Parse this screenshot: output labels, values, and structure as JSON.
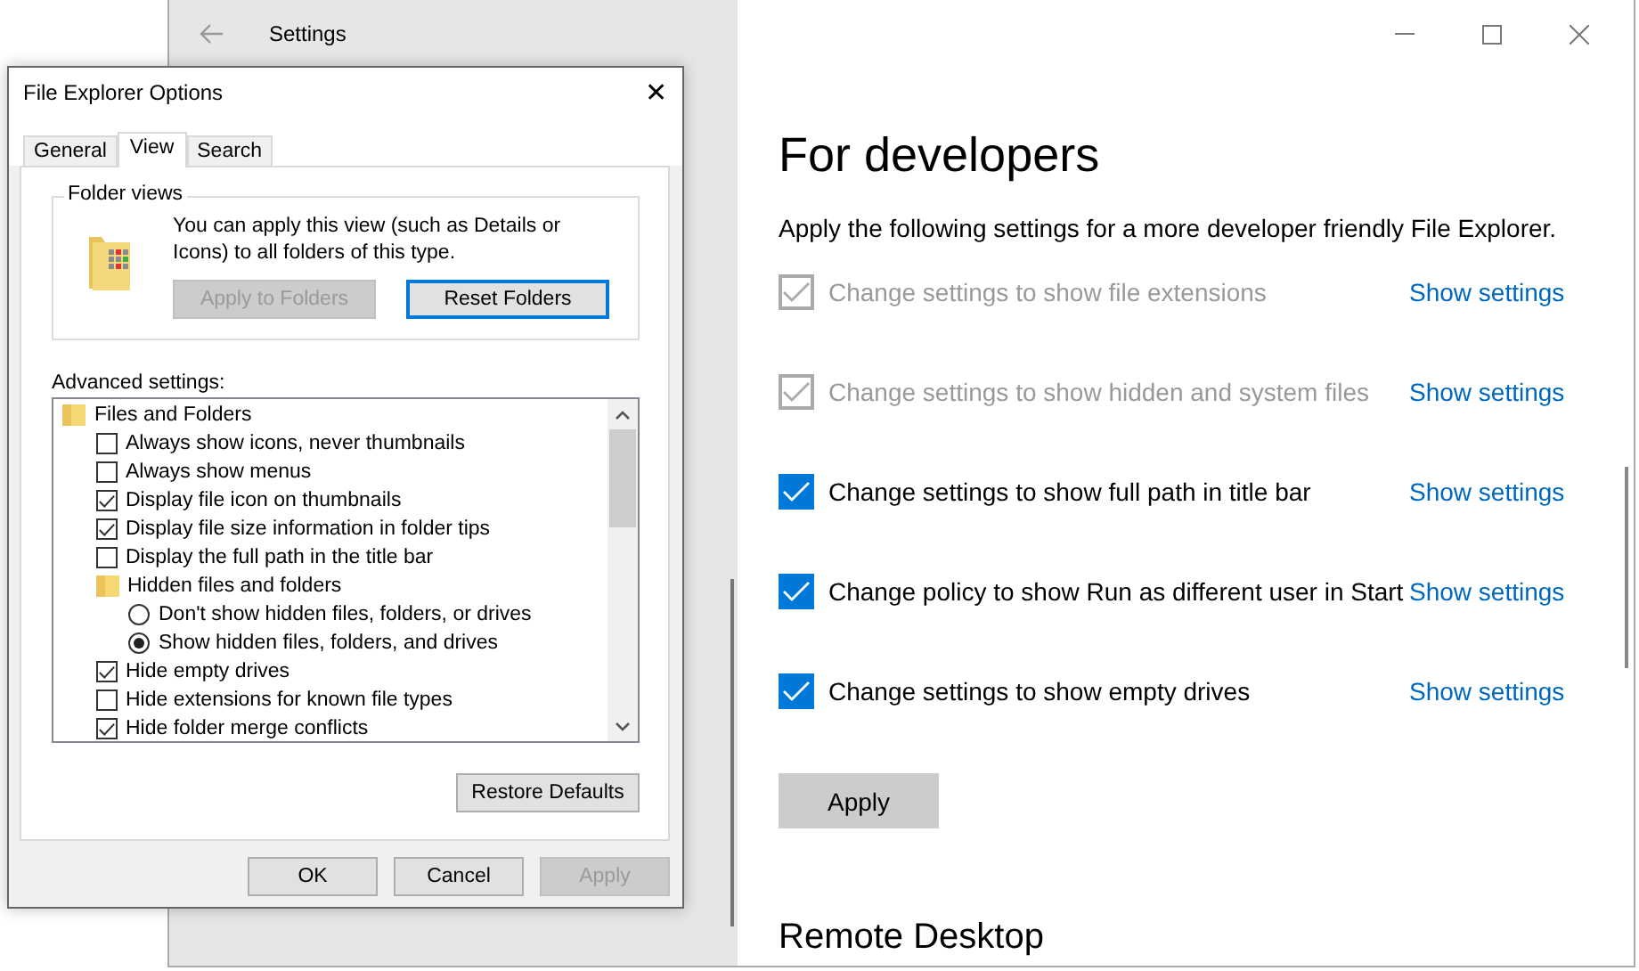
{
  "settings_window": {
    "title": "Settings",
    "heading": "For developers",
    "description": "Apply the following settings for a more developer friendly File Explorer.",
    "options": [
      {
        "label": "Change settings to show file extensions",
        "checked": true,
        "disabled": true,
        "link": "Show settings"
      },
      {
        "label": "Change settings to show hidden and system files",
        "checked": true,
        "disabled": true,
        "link": "Show settings"
      },
      {
        "label": "Change settings to show full path in title bar",
        "checked": true,
        "disabled": false,
        "link": "Show settings"
      },
      {
        "label": "Change policy to show Run as different user in Start",
        "checked": true,
        "disabled": false,
        "link": "Show settings"
      },
      {
        "label": "Change settings to show empty drives",
        "checked": true,
        "disabled": false,
        "link": "Show settings"
      }
    ],
    "apply_button": "Apply",
    "next_heading": "Remote Desktop"
  },
  "dialog": {
    "title": "File Explorer Options",
    "close": "✕",
    "tabs": [
      {
        "label": "General",
        "selected": false
      },
      {
        "label": "View",
        "selected": true
      },
      {
        "label": "Search",
        "selected": false
      }
    ],
    "folder_views": {
      "title": "Folder views",
      "text": "You can apply this view (such as Details or Icons) to all folders of this type.",
      "buttons": [
        {
          "label": "Apply to Folders",
          "disabled": true,
          "focused": false
        },
        {
          "label": "Reset Folders",
          "disabled": false,
          "focused": true
        }
      ]
    },
    "advanced_label": "Advanced settings:",
    "tree": [
      {
        "kind": "folder",
        "label": "Files and Folders",
        "children": [
          {
            "kind": "checkbox",
            "label": "Always show icons, never thumbnails",
            "checked": false
          },
          {
            "kind": "checkbox",
            "label": "Always show menus",
            "checked": false
          },
          {
            "kind": "checkbox",
            "label": "Display file icon on thumbnails",
            "checked": true
          },
          {
            "kind": "checkbox",
            "label": "Display file size information in folder tips",
            "checked": true
          },
          {
            "kind": "checkbox",
            "label": "Display the full path in the title bar",
            "checked": false
          },
          {
            "kind": "folder",
            "label": "Hidden files and folders",
            "children": [
              {
                "kind": "radio",
                "label": "Don't show hidden files, folders, or drives",
                "selected": false
              },
              {
                "kind": "radio",
                "label": "Show hidden files, folders, and drives",
                "selected": true
              }
            ]
          },
          {
            "kind": "checkbox",
            "label": "Hide empty drives",
            "checked": true
          },
          {
            "kind": "checkbox",
            "label": "Hide extensions for known file types",
            "checked": false
          },
          {
            "kind": "checkbox",
            "label": "Hide folder merge conflicts",
            "checked": true
          }
        ]
      }
    ],
    "restore_button": "Restore Defaults",
    "footer_buttons": [
      {
        "label": "OK",
        "disabled": false
      },
      {
        "label": "Cancel",
        "disabled": false
      },
      {
        "label": "Apply",
        "disabled": true
      }
    ]
  }
}
